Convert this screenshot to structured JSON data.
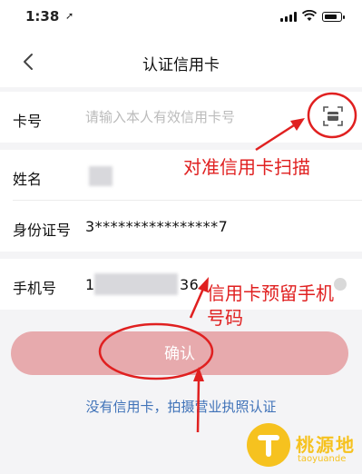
{
  "status_bar": {
    "time": "1:38",
    "location_symbol": "➚"
  },
  "header": {
    "title": "认证信用卡"
  },
  "form": {
    "card_number": {
      "label": "卡号",
      "placeholder": "请输入本人有效信用卡号"
    },
    "name": {
      "label": "姓名"
    },
    "id_number": {
      "label": "身份证号",
      "value": "3****************7"
    },
    "phone": {
      "label": "手机号",
      "value_visible_start": "1",
      "value_visible_end": "36"
    }
  },
  "confirm_button": {
    "label": "确认"
  },
  "alt_link": {
    "label": "没有信用卡，拍摄营业执照认证"
  },
  "annotations": {
    "scan": "对准信用卡扫描",
    "phone_line1": "信用卡预留手机",
    "phone_line2": "号码"
  },
  "watermark": {
    "name": "桃源地",
    "domain": "taoyuande"
  },
  "colors": {
    "accent_button": "#e7aaad",
    "link": "#3f72b8",
    "annotation": "#e02020",
    "watermark": "#f6c21f"
  }
}
